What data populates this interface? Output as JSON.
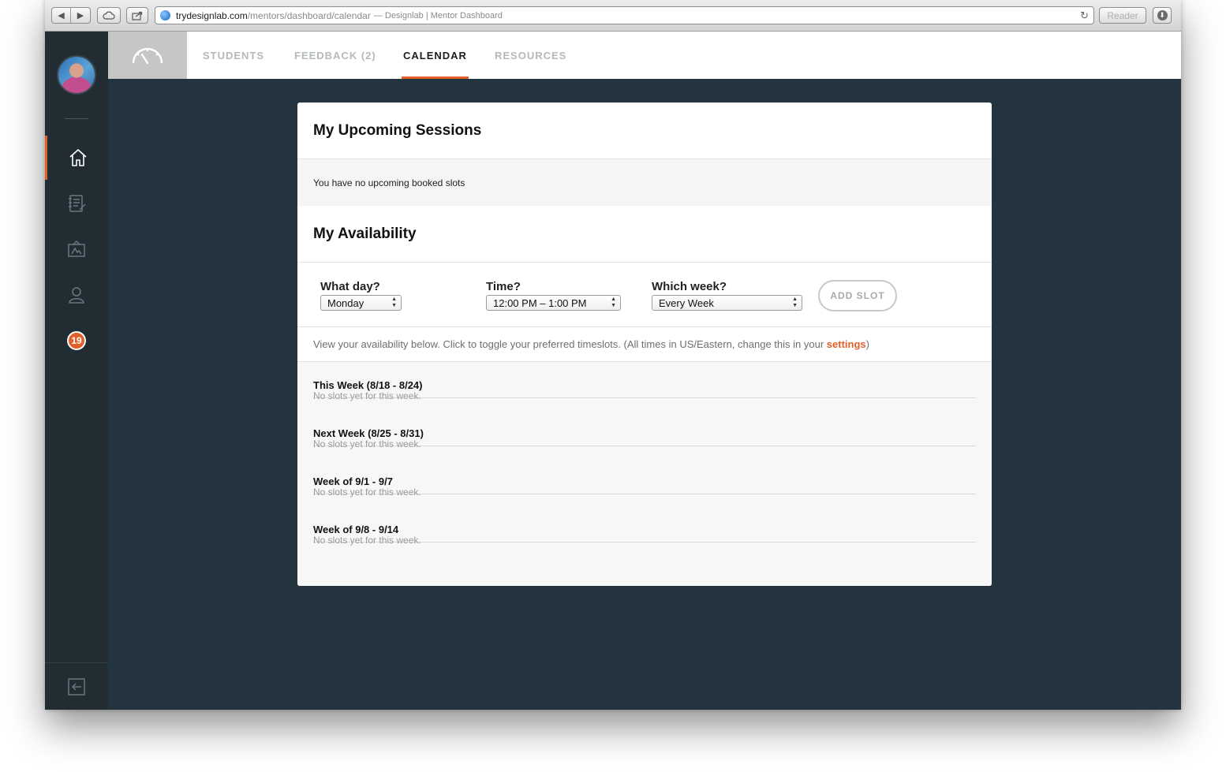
{
  "browser": {
    "url_host": "trydesignlab.com",
    "url_path": "/mentors/dashboard/calendar",
    "page_title": "— Designlab | Mentor Dashboard",
    "reader_label": "Reader"
  },
  "sidebar": {
    "badge_count": "19"
  },
  "tabs": [
    {
      "label": "STUDENTS"
    },
    {
      "label": "FEEDBACK (2)"
    },
    {
      "label": "CALENDAR"
    },
    {
      "label": "RESOURCES"
    }
  ],
  "sessions": {
    "title": "My Upcoming Sessions",
    "empty_text": "You have no upcoming booked slots"
  },
  "availability": {
    "title": "My Availability",
    "day_label": "What day?",
    "day_value": "Monday",
    "time_label": "Time?",
    "time_value": "12:00 PM – 1:00 PM",
    "week_label": "Which week?",
    "week_value": "Every Week",
    "add_slot_label": "ADD SLOT",
    "note_text": "View your availability below. Click to toggle your preferred timeslots. (All times in US/Eastern, change this in your ",
    "note_link": "settings",
    "note_end": ")"
  },
  "weeks": [
    {
      "title": "This Week (8/18 - 8/24)",
      "empty": "No slots yet for this week."
    },
    {
      "title": "Next Week (8/25 - 8/31)",
      "empty": "No slots yet for this week."
    },
    {
      "title": "Week of 9/1 - 9/7",
      "empty": "No slots yet for this week."
    },
    {
      "title": "Week of 9/8 - 9/14",
      "empty": "No slots yet for this week."
    }
  ],
  "colors": {
    "accent": "#e35f29",
    "sidebar_bg": "#222c33",
    "content_bg": "#24343f"
  }
}
